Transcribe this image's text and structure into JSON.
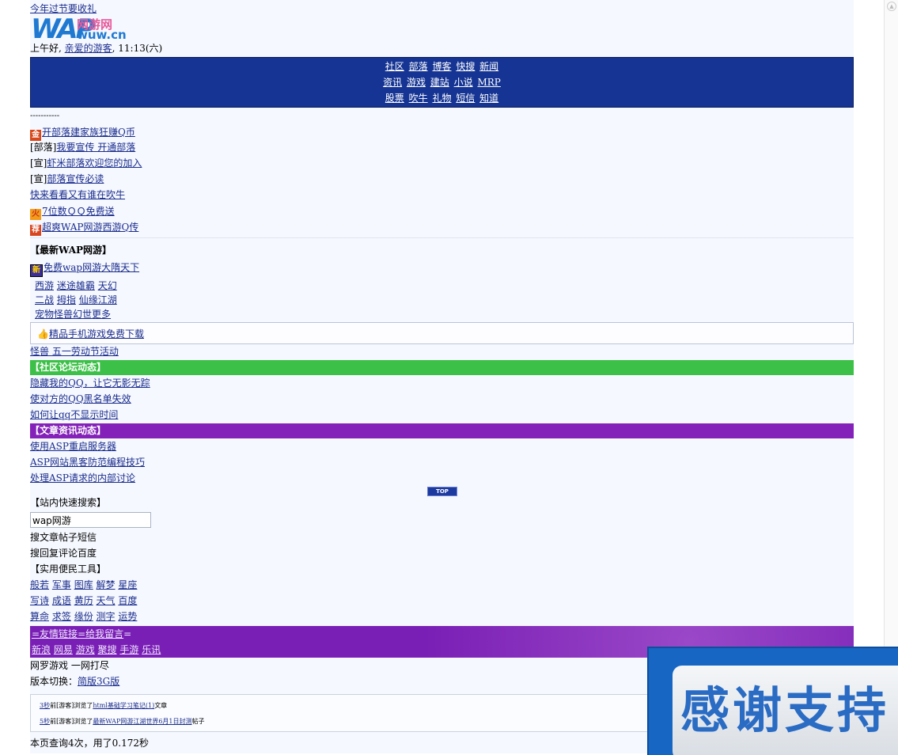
{
  "top_link": "今年过节要收礼",
  "logo": {
    "main": "WAP",
    "cn": "网游网",
    "domain": "wuw.cn"
  },
  "greeting": {
    "prefix": "上午好, ",
    "user": "亲爱的游客",
    "time": ", 11:13(六)"
  },
  "nav": {
    "row1": [
      "社区",
      "部落",
      "博客",
      "快搜",
      "新闻"
    ],
    "row2": [
      "资讯",
      "游戏",
      "建站",
      "小说",
      "MRP"
    ],
    "row3": [
      "股票",
      "吹牛",
      "礼物",
      "短信",
      "知道"
    ]
  },
  "divider": "-----------",
  "promo": [
    {
      "icon": "金",
      "text": "开部落建家族狂赚Q币"
    },
    {
      "prefix": "[部落]",
      "text": "我要宣传 开通部落"
    },
    {
      "prefix": "[宣]",
      "text": "虾米部落欢迎您的加入"
    },
    {
      "prefix": "[宣]",
      "text": "部落宣传必读"
    },
    {
      "text": "快来看看又有谁在吹牛"
    },
    {
      "icon": "火",
      "text": "7位数ＱＱ免费送"
    },
    {
      "icon": "荐",
      "text": "超爽WAP网游西游Q传"
    }
  ],
  "games": {
    "header": "【最新WAP网游】",
    "featured": {
      "icon": "新",
      "text": "免费wap网游大隋天下"
    },
    "row1": [
      "西游",
      "迷途",
      "雄霸",
      "天幻"
    ],
    "row2": [
      "二战",
      "拇指",
      "仙缘",
      "江湖"
    ],
    "row3": [
      "宠物",
      "怪兽",
      "幻世",
      "更多"
    ],
    "download": "精品手机游戏免费下载",
    "event": "怪兽 五一劳动节活动"
  },
  "forum": {
    "header": "【社区论坛动态】",
    "color": "#3cc047",
    "items": [
      "隐藏我的QQ，让它无影无踪",
      "使对方的QQ黑名单失效",
      "如何让qq不显示时间"
    ]
  },
  "articles": {
    "header": "【文章资讯动态】",
    "color": "#8421b8",
    "items": [
      "使用ASP重启服务器",
      "ASP网站黑客防范编程技巧",
      "处理ASP请求的内部讨论"
    ]
  },
  "top_button": "TOP",
  "search": {
    "header": "【站内快速搜索】",
    "value": "wap网游",
    "row1": [
      "搜",
      "文章",
      "帖子",
      "短信"
    ],
    "row2": [
      "搜",
      "回复",
      "评论",
      "百度"
    ]
  },
  "tools": {
    "header": "【实用便民工具】",
    "row1": [
      "般若",
      "军事",
      "图库",
      "解梦",
      "星座"
    ],
    "row2": [
      "写诗",
      "成语",
      "黄历",
      "天气",
      "百度"
    ],
    "row3": [
      "算命",
      "求签",
      "缘份",
      "测字",
      "运势"
    ]
  },
  "friend": {
    "line1_a": "=友情链接",
    "line1_b": "=给我留言",
    "line1_c": "=",
    "links": [
      "新浪",
      "网易",
      "游戏",
      "聚搜",
      "手游",
      "乐讯"
    ]
  },
  "footer_line1": "网罗游戏 一网打尽",
  "version": {
    "label": "版本切换：",
    "opt1": "简版",
    "opt2": "3G版"
  },
  "log": [
    {
      "time": "3秒",
      "mid": "前[游客]浏览了",
      "link": "html基础学习笔记(1)",
      "end": "文章"
    },
    {
      "time": "5秒",
      "mid": "前[游客]浏览了",
      "link": "最新WAP网游江湖世界6月1日封测",
      "end": "帖子"
    }
  ],
  "stats": "本页查询4次，用了0.172秒",
  "banner": "感谢支持"
}
